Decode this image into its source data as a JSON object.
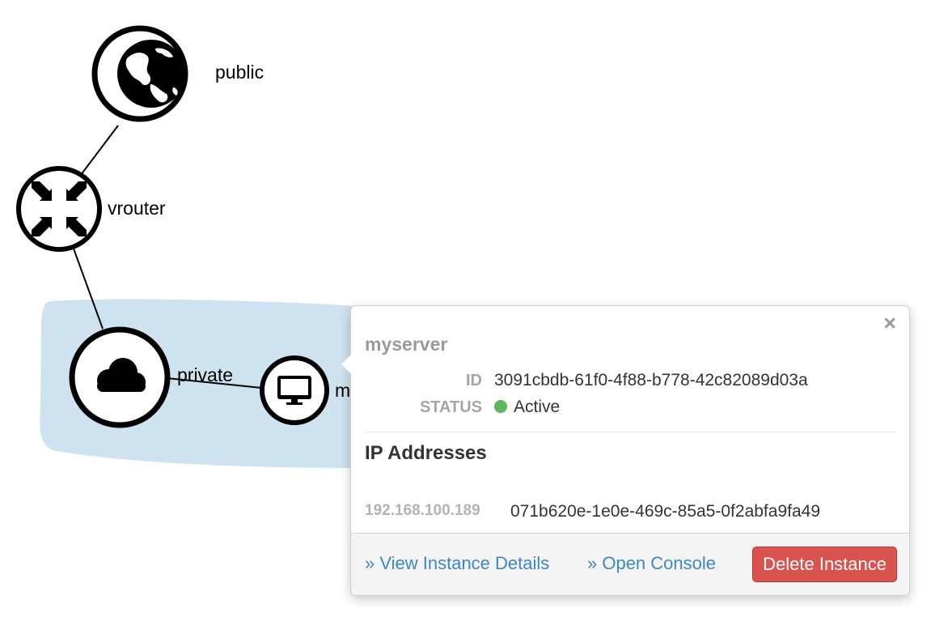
{
  "topology": {
    "nodes": [
      {
        "id": "public",
        "label": "public",
        "icon": "globe-icon"
      },
      {
        "id": "vrouter",
        "label": "vrouter",
        "icon": "router-arrows-icon"
      },
      {
        "id": "private",
        "label": "private",
        "icon": "cloud-icon"
      },
      {
        "id": "myserver",
        "label": "m",
        "icon": "monitor-icon"
      }
    ],
    "network_region_color": "#cfe2ef"
  },
  "popover": {
    "title": "myserver",
    "close_symbol": "×",
    "id_key": "ID",
    "id_value": "3091cbdb-61f0-4f88-b778-42c82089d03a",
    "status_key": "STATUS",
    "status_value": "Active",
    "status_color": "#5cb85c",
    "ip_section_title": "IP Addresses",
    "ip_addresses": [
      {
        "address": "192.168.100.189",
        "port_id": "071b620e-1e0e-469c-85a5-0f2abfa9fa49"
      }
    ],
    "footer": {
      "view_details": "» View Instance Details",
      "open_console": "» Open Console",
      "delete": "Delete Instance"
    }
  },
  "colors": {
    "link": "#3c87c8",
    "danger": "#d9534f"
  }
}
